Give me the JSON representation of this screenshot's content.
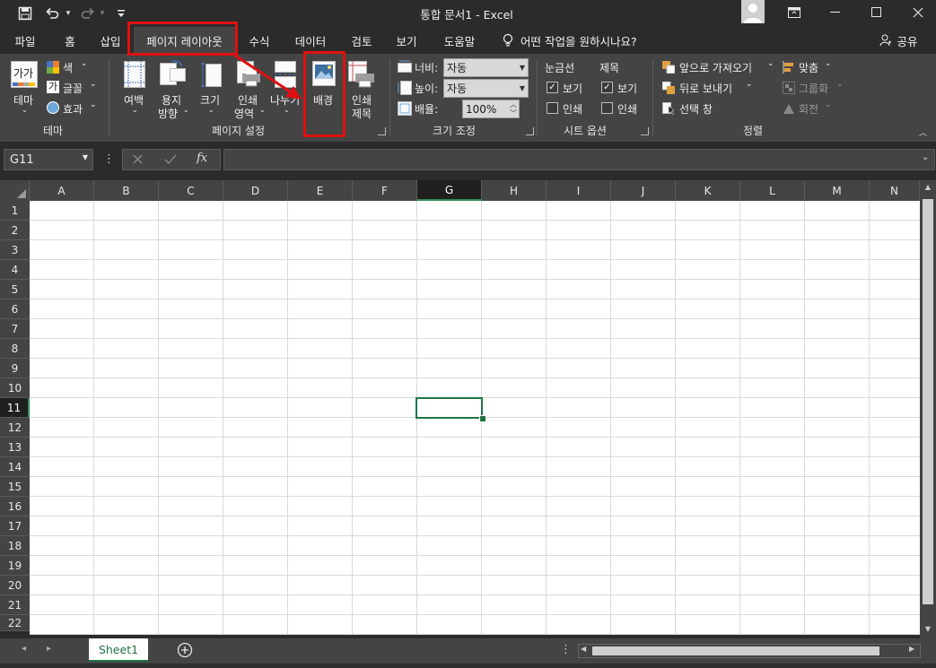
{
  "title_bar": {
    "document_title": "통합 문서1  -  Excel",
    "qat_icons": [
      "save-icon",
      "undo-icon",
      "redo-icon",
      "customize-icon"
    ],
    "window_controls": [
      "ribbon-display-icon",
      "minimize-icon",
      "maximize-icon",
      "close-icon"
    ]
  },
  "tabs": [
    {
      "label": "파일",
      "active": false
    },
    {
      "label": "홈",
      "active": false
    },
    {
      "label": "삽입",
      "active": false
    },
    {
      "label": "페이지 레이아웃",
      "active": true
    },
    {
      "label": "수식",
      "active": false
    },
    {
      "label": "데이터",
      "active": false
    },
    {
      "label": "검토",
      "active": false
    },
    {
      "label": "보기",
      "active": false
    },
    {
      "label": "도움말",
      "active": false
    }
  ],
  "tell_me": "어떤 작업을 원하시나요?",
  "share_label": "공유",
  "ribbon": {
    "theme_group": {
      "name": "테마",
      "theme_button": "테마",
      "theme_icon_text": "가가",
      "colors": "색",
      "fonts": "글꼴",
      "font_icon_text": "가",
      "effects": "효과"
    },
    "page_setup_group": {
      "name": "페이지 설정",
      "margins": "여백",
      "orientation_line1": "용지",
      "orientation_line2": "방향",
      "size": "크기",
      "print_area_line1": "인쇄",
      "print_area_line2": "영역",
      "breaks": "나누기",
      "background": "배경",
      "print_titles_line1": "인쇄",
      "print_titles_line2": "제목"
    },
    "scale_group": {
      "name": "크기 조정",
      "width_label": "너비:",
      "width_value": "자동",
      "height_label": "높이:",
      "height_value": "자동",
      "scale_label": "배율:",
      "scale_value": "100%"
    },
    "sheet_options_group": {
      "name": "시트 옵션",
      "gridlines": "눈금선",
      "headings": "제목",
      "view": "보기",
      "print": "인쇄",
      "gridlines_view_checked": true,
      "gridlines_print_checked": false,
      "headings_view_checked": true,
      "headings_print_checked": false
    },
    "arrange_group": {
      "name": "정렬",
      "bring_forward": "앞으로 가져오기",
      "send_backward": "뒤로 보내기",
      "selection_pane": "선택 창",
      "align": "맞춤",
      "group": "그룹화",
      "rotate": "회전"
    }
  },
  "formula_bar": {
    "name_box": "G11",
    "formula": "",
    "fx_label": "fx"
  },
  "columns": [
    "A",
    "B",
    "C",
    "D",
    "E",
    "F",
    "G",
    "H",
    "I",
    "J",
    "K",
    "L",
    "M",
    "N"
  ],
  "rows": [
    "1",
    "2",
    "3",
    "4",
    "5",
    "6",
    "7",
    "8",
    "9",
    "10",
    "11",
    "12",
    "13",
    "14",
    "15",
    "16",
    "17",
    "18",
    "19",
    "20",
    "21",
    "22"
  ],
  "selected_cell": {
    "column": "G",
    "row": "11"
  },
  "sheets": [
    {
      "name": "Sheet1",
      "active": true
    }
  ],
  "colors": {
    "dark_bg": "#2b2b2b",
    "ribbon_bg": "#444444",
    "selection_green": "#217346",
    "annotation_red": "#e01010"
  }
}
